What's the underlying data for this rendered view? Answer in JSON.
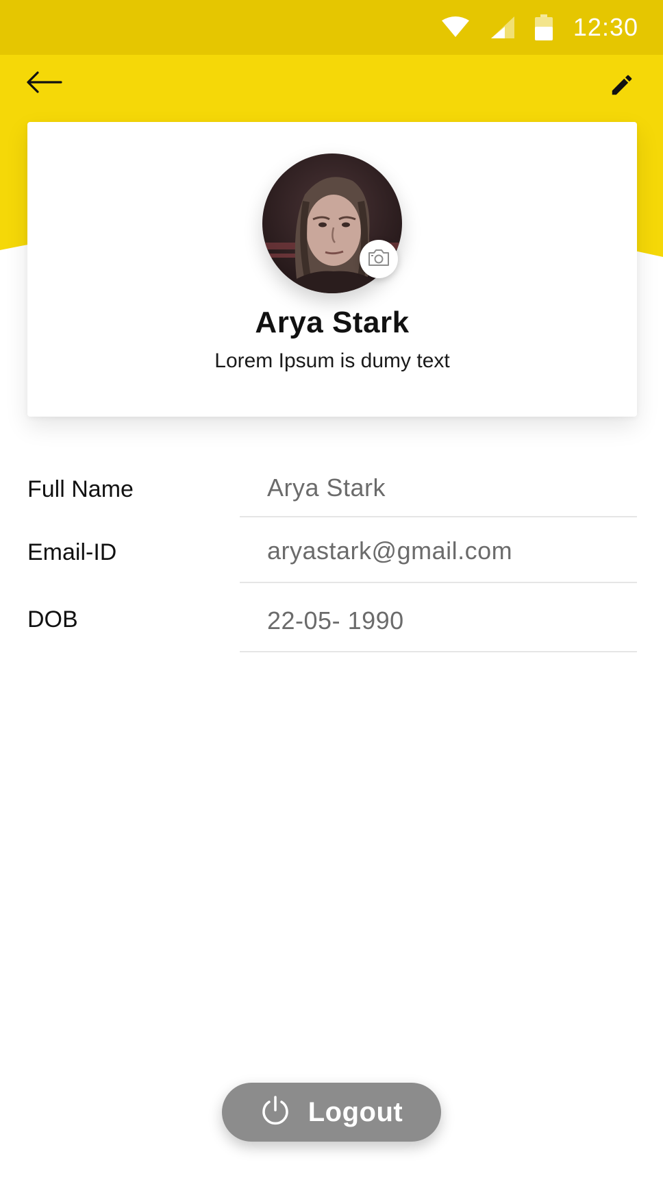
{
  "colors": {
    "status_bar": "#e5c601",
    "header": "#f5d808",
    "logout_button": "#8c8c8c"
  },
  "status_bar": {
    "time": "12:30",
    "icons": [
      "wifi-icon",
      "signal-icon",
      "battery-icon"
    ]
  },
  "toolbar": {
    "back_icon": "arrow-left-icon",
    "edit_icon": "pencil-icon"
  },
  "profile": {
    "avatar_icon": "avatar-photo",
    "camera_icon": "camera-icon",
    "name": "Arya Stark",
    "tagline": "Lorem Ipsum is dumy text"
  },
  "details": [
    {
      "label": "Full Name",
      "value": "Arya Stark"
    },
    {
      "label": "Email-ID",
      "value": "aryastark@gmail.com"
    },
    {
      "label": "DOB",
      "value": "22-05- 1990"
    }
  ],
  "logout": {
    "label": "Logout",
    "icon": "power-icon"
  }
}
